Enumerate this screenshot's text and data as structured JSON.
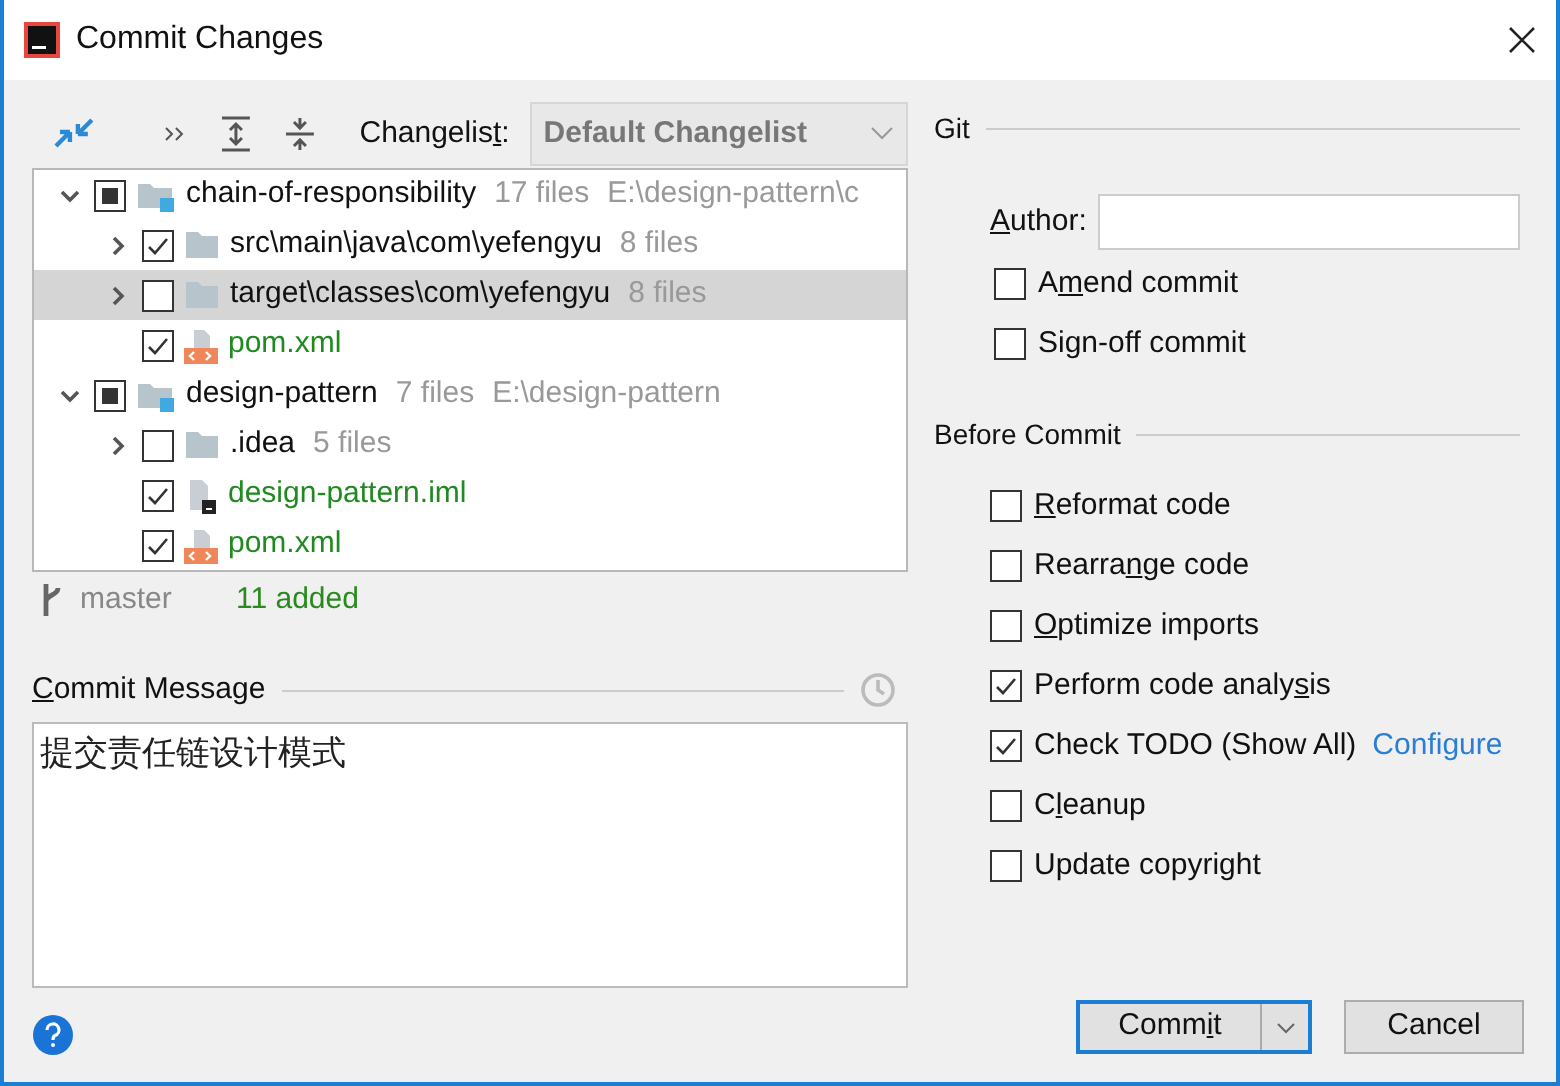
{
  "window": {
    "title": "Commit Changes"
  },
  "toolbar": {
    "changelist_label": {
      "pre": "Changelis",
      "mnemonic": "t",
      "post": ":"
    },
    "changelist_value": "Default Changelist"
  },
  "tree": [
    {
      "kind": "module",
      "label": "chain-of-responsibility",
      "count": "17 files",
      "path": "E:\\design-pattern\\c",
      "checked": true,
      "partial": true,
      "expanded": true,
      "selected": false,
      "children": [
        {
          "kind": "folder",
          "label": "src\\main\\java\\com\\yefengyu",
          "count": "8 files",
          "checked": true,
          "expanded": false,
          "selected": false
        },
        {
          "kind": "folder",
          "label": "target\\classes\\com\\yefengyu",
          "count": "8 files",
          "checked": false,
          "expanded": false,
          "selected": true
        },
        {
          "kind": "xml",
          "label": "pom.xml",
          "checked": true,
          "selected": false
        }
      ]
    },
    {
      "kind": "module",
      "label": "design-pattern",
      "count": "7 files",
      "path": "E:\\design-pattern",
      "checked": true,
      "partial": true,
      "expanded": true,
      "selected": false,
      "children": [
        {
          "kind": "folder",
          "label": ".idea",
          "count": "5 files",
          "checked": false,
          "expanded": false,
          "selected": false
        },
        {
          "kind": "iml",
          "label": "design-pattern.iml",
          "checked": true,
          "selected": false
        },
        {
          "kind": "xml",
          "label": "pom.xml",
          "checked": true,
          "selected": false
        }
      ]
    }
  ],
  "status": {
    "branch": "master",
    "added": "11 added"
  },
  "commit_message": {
    "label": {
      "mnemonic": "C",
      "post": "ommit Message"
    },
    "value": "提交责任链设计模式"
  },
  "git": {
    "title": "Git",
    "author_label": {
      "mnemonic": "A",
      "post": "uthor:"
    },
    "options": [
      {
        "label": {
          "pre": "A",
          "mnemonic": "m",
          "post": "end commit"
        },
        "checked": false
      },
      {
        "label": {
          "pre": "Sign-off commit"
        },
        "checked": false
      }
    ]
  },
  "before_commit": {
    "title": "Before Commit",
    "options": [
      {
        "label": {
          "mnemonic": "R",
          "post": "eformat code"
        },
        "checked": false
      },
      {
        "label": {
          "pre": "Rearra",
          "mnemonic": "n",
          "post": "ge code"
        },
        "checked": false
      },
      {
        "label": {
          "mnemonic": "O",
          "post": "ptimize imports"
        },
        "checked": false
      },
      {
        "label": {
          "pre": "Perform code analy",
          "mnemonic": "s",
          "post": "is"
        },
        "checked": true
      },
      {
        "label": {
          "pre": "Check TODO (Show All)"
        },
        "checked": true,
        "link": "Configure"
      },
      {
        "label": {
          "pre": "C",
          "mnemonic": "l",
          "post": "eanup"
        },
        "checked": false
      },
      {
        "label": {
          "pre": "Update copyright"
        },
        "checked": false
      }
    ]
  },
  "buttons": {
    "commit": {
      "pre": "Comm",
      "mnemonic": "i",
      "post": "t"
    },
    "cancel": "Cancel"
  }
}
